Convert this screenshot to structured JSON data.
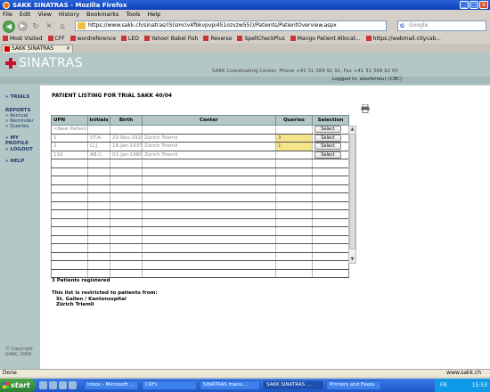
{
  "window": {
    "title": "SAKK SINATRAS - Mozilla Firefox"
  },
  "menu": [
    "File",
    "Edit",
    "View",
    "History",
    "Bookmarks",
    "Tools",
    "Help"
  ],
  "nav": {
    "url": "https://www.sakk.ch/sinatras/(S(smciv4fbkvpvpi451ozvzw55))/Patients/PatientOverview.aspx",
    "search_placeholder": "Google"
  },
  "bookmarks": [
    "Most Visited",
    "CFF",
    "wordreference",
    "LEO",
    "Yahoo! Babel Fish",
    "Reverso",
    "SpellCheckPlus",
    "Mango Patient Allocat...",
    "https://webmail.citycab..."
  ],
  "tab": {
    "label": "SAKK SINATRAS"
  },
  "app": {
    "logo_text": "SINATRAS",
    "contact": "SAKK Coordinating Center, Phone +41 31 389 91 91, Fax +41 31 389 92 00",
    "logged_in": "Logged in: alexferreur (CRC)"
  },
  "sidebar": {
    "trials": "» TRIALS",
    "reports": "REPORTS",
    "report_items": [
      "» Accrual",
      "» Reminder",
      "» Queries"
    ],
    "my_profile": "» MY PROFILE",
    "logout": "» LOGOUT",
    "help": "» HELP",
    "copyright_1": "© Copyright",
    "copyright_2": "SAKK, 2009"
  },
  "page": {
    "title": "PATIENT LISTING FOR TRIAL SAKK 40/04",
    "count": "3 Patients registered",
    "restrict_text": "This list is restricted to patients from:",
    "sites": [
      "St. Gallen / Kantonsspital",
      "Zürich Triemli"
    ]
  },
  "table": {
    "headers": [
      "UPN",
      "Initials",
      "Birth",
      "Center",
      "Queries",
      "Selection"
    ],
    "new_patient": "<New Patient>",
    "select_label": "Select",
    "rows": [
      {
        "upn": "1",
        "initials": "ST.A.",
        "birth": "22-Nov-1928",
        "center": "Zürich Triemli",
        "queries": "3"
      },
      {
        "upn": "2",
        "initials": "LI.J.",
        "birth": "18-Jan-1937",
        "center": "Zürich Triemli",
        "queries": "1"
      },
      {
        "upn": "110",
        "initials": "AB.C.",
        "birth": "01-Jan-1980",
        "center": "Zürich Triemli",
        "queries": ""
      }
    ]
  },
  "status": {
    "left": "Done",
    "right": "www.sakk.ch"
  },
  "taskbar": {
    "start": "start",
    "tasks": [
      "Inbox - Microsoft ...",
      "CRFs",
      "SINATRAS manu...",
      "SAKK SINATRAS ...",
      "Printers and Faxes"
    ],
    "lang": "FR",
    "time": "15:53"
  }
}
